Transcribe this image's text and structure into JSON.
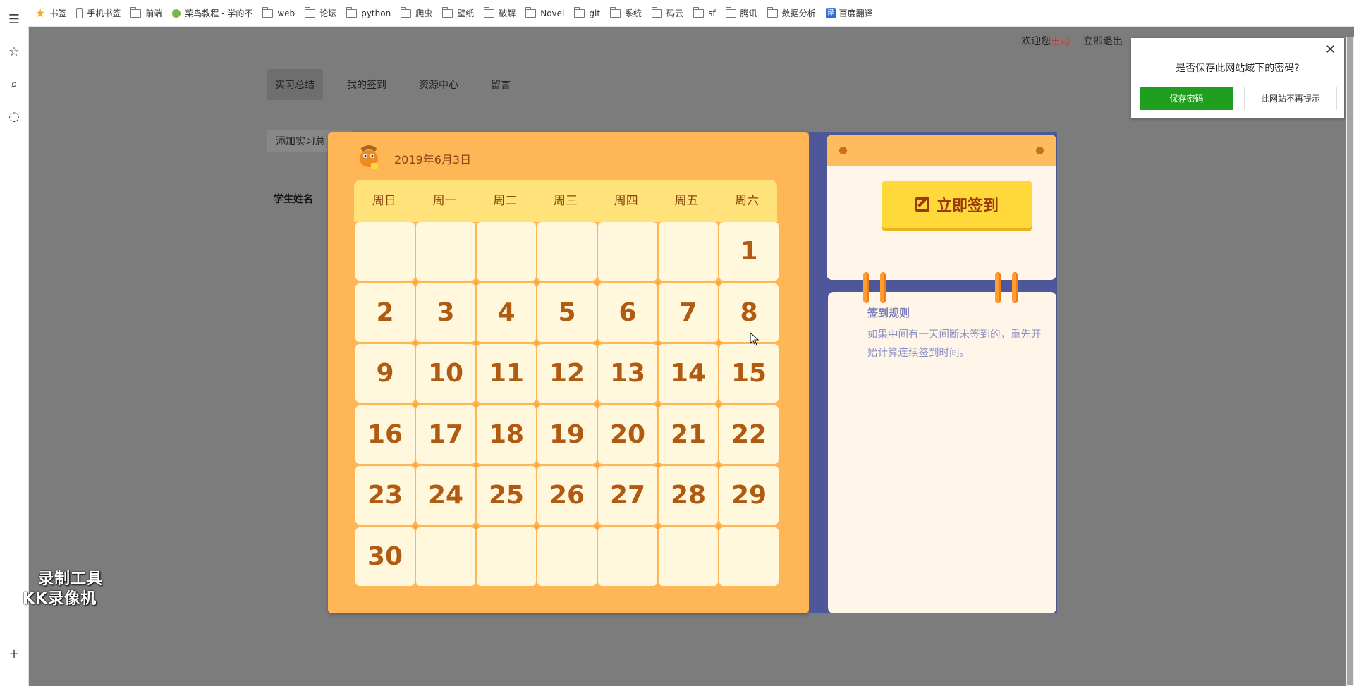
{
  "bookmarks": [
    {
      "icon": "star-icon",
      "label": "书签"
    },
    {
      "icon": "phone-icon",
      "label": "手机书签"
    },
    {
      "icon": "folder-icon",
      "label": "前端"
    },
    {
      "icon": "runoob-icon",
      "label": "菜鸟教程 - 学的不"
    },
    {
      "icon": "folder-icon",
      "label": "web"
    },
    {
      "icon": "folder-icon",
      "label": "论坛"
    },
    {
      "icon": "folder-icon",
      "label": "python"
    },
    {
      "icon": "folder-icon",
      "label": "爬虫"
    },
    {
      "icon": "folder-icon",
      "label": "壁纸"
    },
    {
      "icon": "folder-icon",
      "label": "破解"
    },
    {
      "icon": "folder-icon",
      "label": "Novel"
    },
    {
      "icon": "folder-icon",
      "label": "git"
    },
    {
      "icon": "folder-icon",
      "label": "系统"
    },
    {
      "icon": "folder-icon",
      "label": "码云"
    },
    {
      "icon": "folder-icon",
      "label": "sf"
    },
    {
      "icon": "folder-icon",
      "label": "腾讯"
    },
    {
      "icon": "folder-icon",
      "label": "数据分析"
    },
    {
      "icon": "baidu-translate-icon",
      "label": "百度翻译"
    }
  ],
  "header": {
    "welcome": "欢迎您",
    "username": "王可",
    "logout": "立即退出"
  },
  "nav": [
    "实习总结",
    "我的签到",
    "资源中心",
    "留言"
  ],
  "page": {
    "add_summary": "添加实习总",
    "student_label": "学生姓名"
  },
  "calendar": {
    "date": "2019年6月3日",
    "weekdays": [
      "周日",
      "周一",
      "周二",
      "周三",
      "周四",
      "周五",
      "周六"
    ],
    "days": [
      "",
      "",
      "",
      "",
      "",
      "",
      "1",
      "2",
      "3",
      "4",
      "5",
      "6",
      "7",
      "8",
      "9",
      "10",
      "11",
      "12",
      "13",
      "14",
      "15",
      "16",
      "17",
      "18",
      "19",
      "20",
      "21",
      "22",
      "23",
      "24",
      "25",
      "26",
      "27",
      "28",
      "29",
      "30",
      "",
      "",
      "",
      "",
      "",
      ""
    ]
  },
  "signin": {
    "button": "立即签到",
    "rule_title": "签到规则",
    "rule_text": "如果中间有一天间断未签到的，重先开始计算连续签到时间。"
  },
  "password_prompt": {
    "question": "是否保存此网站域下的密码?",
    "save": "保存密码",
    "never": "此网站不再提示"
  },
  "watermark": {
    "line1": "录制工具",
    "line2": "KK录像机"
  },
  "colors": {
    "calendar_bg": "#ffb657",
    "week_header": "#ffe37a",
    "cell": "#fff8dc",
    "day_text": "#b05a12",
    "signin_btn": "#ffd93a",
    "panel_bg": "#4e579a",
    "save_btn": "#1f9e1f"
  }
}
